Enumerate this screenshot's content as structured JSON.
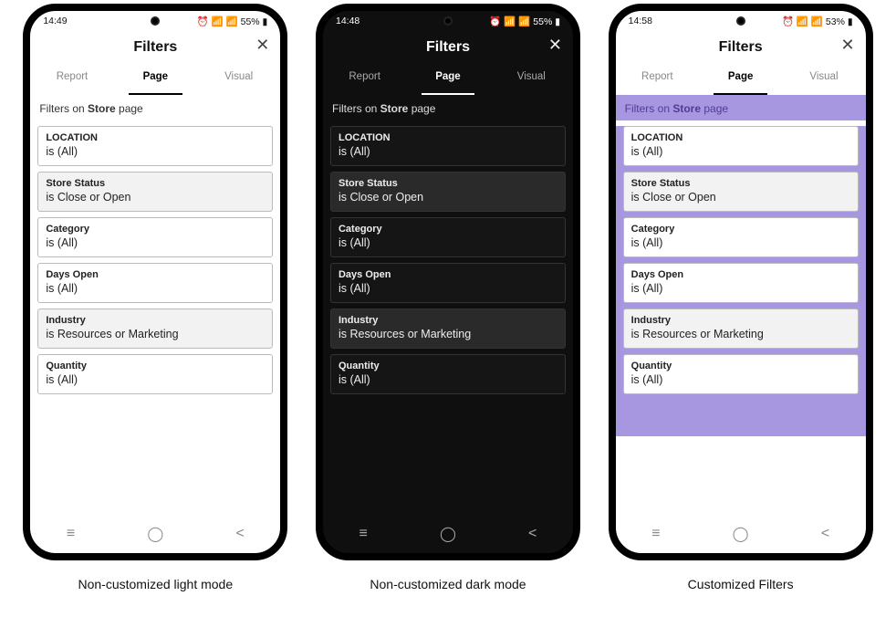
{
  "captions": {
    "light": "Non-customized light mode",
    "dark": "Non-customized dark mode",
    "custom": "Customized Filters"
  },
  "status": {
    "light_time": "14:49",
    "dark_time": "14:48",
    "custom_time": "14:58",
    "light_right": "55%",
    "dark_right": "55%",
    "custom_right": "53%"
  },
  "header": {
    "title": "Filters"
  },
  "tabs": {
    "report": "Report",
    "page": "Page",
    "visual": "Visual"
  },
  "subhead": {
    "prefix": "Filters on ",
    "bold": "Store",
    "suffix": " page"
  },
  "filters": {
    "location": {
      "label": "LOCATION",
      "value": "is (All)"
    },
    "storeStatus": {
      "label": "Store Status",
      "value": "is Close or Open"
    },
    "category": {
      "label": "Category",
      "value": "is (All)"
    },
    "daysOpen": {
      "label": "Days Open",
      "value": "is (All)"
    },
    "industry": {
      "label": "Industry",
      "value": "is Resources or Marketing"
    },
    "quantity": {
      "label": "Quantity",
      "value": "is (All)"
    }
  }
}
